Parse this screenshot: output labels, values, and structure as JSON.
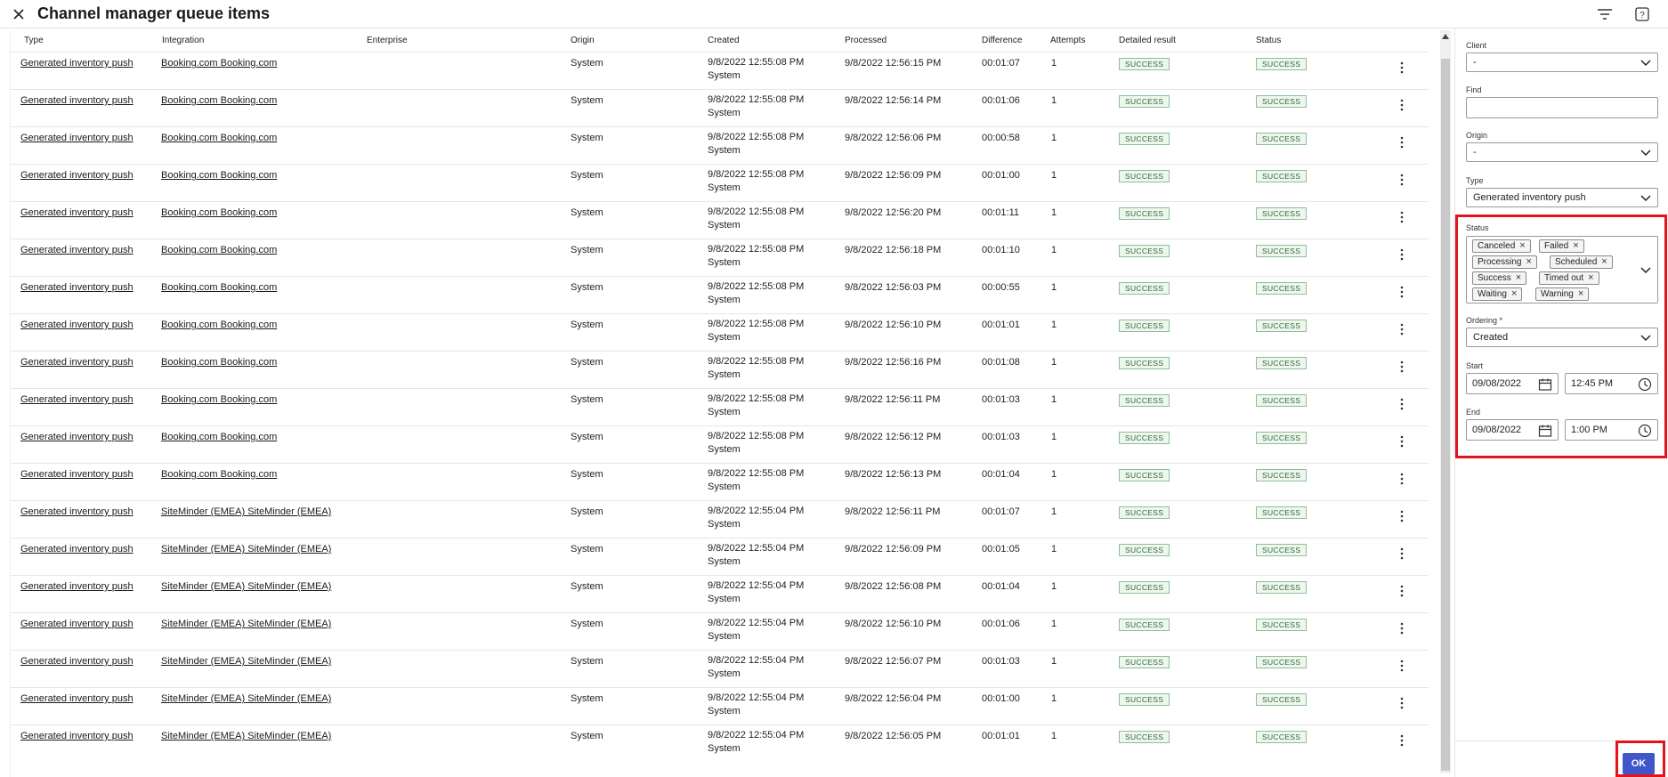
{
  "header": {
    "title": "Channel manager queue items",
    "close_icon": "close-icon",
    "filter_icon": "filter-icon",
    "help_icon": "help-icon"
  },
  "table": {
    "columns": {
      "type": "Type",
      "integration": "Integration",
      "enterprise": "Enterprise",
      "origin": "Origin",
      "created": "Created",
      "processed": "Processed",
      "difference": "Difference",
      "attempts": "Attempts",
      "detailed_result": "Detailed result",
      "status": "Status"
    },
    "rows": [
      {
        "type": "Generated inventory push",
        "integration": "Booking.com Booking.com",
        "enterprise": "",
        "origin": "System",
        "created": "9/8/2022 12:55:08 PM",
        "created_by": "System",
        "processed": "9/8/2022 12:56:15 PM",
        "difference": "00:01:07",
        "attempts": "1",
        "detailed_result": "SUCCESS",
        "status": "SUCCESS"
      },
      {
        "type": "Generated inventory push",
        "integration": "Booking.com Booking.com",
        "enterprise": "",
        "origin": "System",
        "created": "9/8/2022 12:55:08 PM",
        "created_by": "System",
        "processed": "9/8/2022 12:56:14 PM",
        "difference": "00:01:06",
        "attempts": "1",
        "detailed_result": "SUCCESS",
        "status": "SUCCESS"
      },
      {
        "type": "Generated inventory push",
        "integration": "Booking.com Booking.com",
        "enterprise": "",
        "origin": "System",
        "created": "9/8/2022 12:55:08 PM",
        "created_by": "System",
        "processed": "9/8/2022 12:56:06 PM",
        "difference": "00:00:58",
        "attempts": "1",
        "detailed_result": "SUCCESS",
        "status": "SUCCESS"
      },
      {
        "type": "Generated inventory push",
        "integration": "Booking.com Booking.com",
        "enterprise": "",
        "origin": "System",
        "created": "9/8/2022 12:55:08 PM",
        "created_by": "System",
        "processed": "9/8/2022 12:56:09 PM",
        "difference": "00:01:00",
        "attempts": "1",
        "detailed_result": "SUCCESS",
        "status": "SUCCESS"
      },
      {
        "type": "Generated inventory push",
        "integration": "Booking.com Booking.com",
        "enterprise": "",
        "origin": "System",
        "created": "9/8/2022 12:55:08 PM",
        "created_by": "System",
        "processed": "9/8/2022 12:56:20 PM",
        "difference": "00:01:11",
        "attempts": "1",
        "detailed_result": "SUCCESS",
        "status": "SUCCESS"
      },
      {
        "type": "Generated inventory push",
        "integration": "Booking.com Booking.com",
        "enterprise": "",
        "origin": "System",
        "created": "9/8/2022 12:55:08 PM",
        "created_by": "System",
        "processed": "9/8/2022 12:56:18 PM",
        "difference": "00:01:10",
        "attempts": "1",
        "detailed_result": "SUCCESS",
        "status": "SUCCESS"
      },
      {
        "type": "Generated inventory push",
        "integration": "Booking.com Booking.com",
        "enterprise": "",
        "origin": "System",
        "created": "9/8/2022 12:55:08 PM",
        "created_by": "System",
        "processed": "9/8/2022 12:56:03 PM",
        "difference": "00:00:55",
        "attempts": "1",
        "detailed_result": "SUCCESS",
        "status": "SUCCESS"
      },
      {
        "type": "Generated inventory push",
        "integration": "Booking.com Booking.com",
        "enterprise": "",
        "origin": "System",
        "created": "9/8/2022 12:55:08 PM",
        "created_by": "System",
        "processed": "9/8/2022 12:56:10 PM",
        "difference": "00:01:01",
        "attempts": "1",
        "detailed_result": "SUCCESS",
        "status": "SUCCESS"
      },
      {
        "type": "Generated inventory push",
        "integration": "Booking.com Booking.com",
        "enterprise": "",
        "origin": "System",
        "created": "9/8/2022 12:55:08 PM",
        "created_by": "System",
        "processed": "9/8/2022 12:56:16 PM",
        "difference": "00:01:08",
        "attempts": "1",
        "detailed_result": "SUCCESS",
        "status": "SUCCESS"
      },
      {
        "type": "Generated inventory push",
        "integration": "Booking.com Booking.com",
        "enterprise": "",
        "origin": "System",
        "created": "9/8/2022 12:55:08 PM",
        "created_by": "System",
        "processed": "9/8/2022 12:56:11 PM",
        "difference": "00:01:03",
        "attempts": "1",
        "detailed_result": "SUCCESS",
        "status": "SUCCESS"
      },
      {
        "type": "Generated inventory push",
        "integration": "Booking.com Booking.com",
        "enterprise": "",
        "origin": "System",
        "created": "9/8/2022 12:55:08 PM",
        "created_by": "System",
        "processed": "9/8/2022 12:56:12 PM",
        "difference": "00:01:03",
        "attempts": "1",
        "detailed_result": "SUCCESS",
        "status": "SUCCESS"
      },
      {
        "type": "Generated inventory push",
        "integration": "Booking.com Booking.com",
        "enterprise": "",
        "origin": "System",
        "created": "9/8/2022 12:55:08 PM",
        "created_by": "System",
        "processed": "9/8/2022 12:56:13 PM",
        "difference": "00:01:04",
        "attempts": "1",
        "detailed_result": "SUCCESS",
        "status": "SUCCESS"
      },
      {
        "type": "Generated inventory push",
        "integration": "SiteMinder (EMEA) SiteMinder (EMEA)",
        "enterprise": "",
        "origin": "System",
        "created": "9/8/2022 12:55:04 PM",
        "created_by": "System",
        "processed": "9/8/2022 12:56:11 PM",
        "difference": "00:01:07",
        "attempts": "1",
        "detailed_result": "SUCCESS",
        "status": "SUCCESS"
      },
      {
        "type": "Generated inventory push",
        "integration": "SiteMinder (EMEA) SiteMinder (EMEA)",
        "enterprise": "",
        "origin": "System",
        "created": "9/8/2022 12:55:04 PM",
        "created_by": "System",
        "processed": "9/8/2022 12:56:09 PM",
        "difference": "00:01:05",
        "attempts": "1",
        "detailed_result": "SUCCESS",
        "status": "SUCCESS"
      },
      {
        "type": "Generated inventory push",
        "integration": "SiteMinder (EMEA) SiteMinder (EMEA)",
        "enterprise": "",
        "origin": "System",
        "created": "9/8/2022 12:55:04 PM",
        "created_by": "System",
        "processed": "9/8/2022 12:56:08 PM",
        "difference": "00:01:04",
        "attempts": "1",
        "detailed_result": "SUCCESS",
        "status": "SUCCESS"
      },
      {
        "type": "Generated inventory push",
        "integration": "SiteMinder (EMEA) SiteMinder (EMEA)",
        "enterprise": "",
        "origin": "System",
        "created": "9/8/2022 12:55:04 PM",
        "created_by": "System",
        "processed": "9/8/2022 12:56:10 PM",
        "difference": "00:01:06",
        "attempts": "1",
        "detailed_result": "SUCCESS",
        "status": "SUCCESS"
      },
      {
        "type": "Generated inventory push",
        "integration": "SiteMinder (EMEA) SiteMinder (EMEA)",
        "enterprise": "",
        "origin": "System",
        "created": "9/8/2022 12:55:04 PM",
        "created_by": "System",
        "processed": "9/8/2022 12:56:07 PM",
        "difference": "00:01:03",
        "attempts": "1",
        "detailed_result": "SUCCESS",
        "status": "SUCCESS"
      },
      {
        "type": "Generated inventory push",
        "integration": "SiteMinder (EMEA) SiteMinder (EMEA)",
        "enterprise": "",
        "origin": "System",
        "created": "9/8/2022 12:55:04 PM",
        "created_by": "System",
        "processed": "9/8/2022 12:56:04 PM",
        "difference": "00:01:00",
        "attempts": "1",
        "detailed_result": "SUCCESS",
        "status": "SUCCESS"
      },
      {
        "type": "Generated inventory push",
        "integration": "SiteMinder (EMEA) SiteMinder (EMEA)",
        "enterprise": "",
        "origin": "System",
        "created": "9/8/2022 12:55:04 PM",
        "created_by": "System",
        "processed": "9/8/2022 12:56:05 PM",
        "difference": "00:01:01",
        "attempts": "1",
        "detailed_result": "SUCCESS",
        "status": "SUCCESS"
      }
    ]
  },
  "filters": {
    "client": {
      "label": "Client",
      "value": "-"
    },
    "find": {
      "label": "Find",
      "value": ""
    },
    "origin": {
      "label": "Origin",
      "value": "-"
    },
    "type": {
      "label": "Type",
      "value": "Generated inventory push"
    },
    "status": {
      "label": "Status",
      "chips": [
        "Canceled",
        "Failed",
        "Processing",
        "Scheduled",
        "Success",
        "Timed out",
        "Waiting",
        "Warning"
      ]
    },
    "ordering": {
      "label": "Ordering *",
      "value": "Created"
    },
    "start": {
      "label": "Start",
      "date": "09/08/2022",
      "time": "12:45 PM"
    },
    "end": {
      "label": "End",
      "date": "09/08/2022",
      "time": "1:00 PM"
    },
    "ok_label": "OK"
  },
  "colors": {
    "accent": "#3f57c9",
    "highlight": "#e3141d",
    "success_text": "#2e6b3a",
    "success_border": "#8fbf95"
  }
}
